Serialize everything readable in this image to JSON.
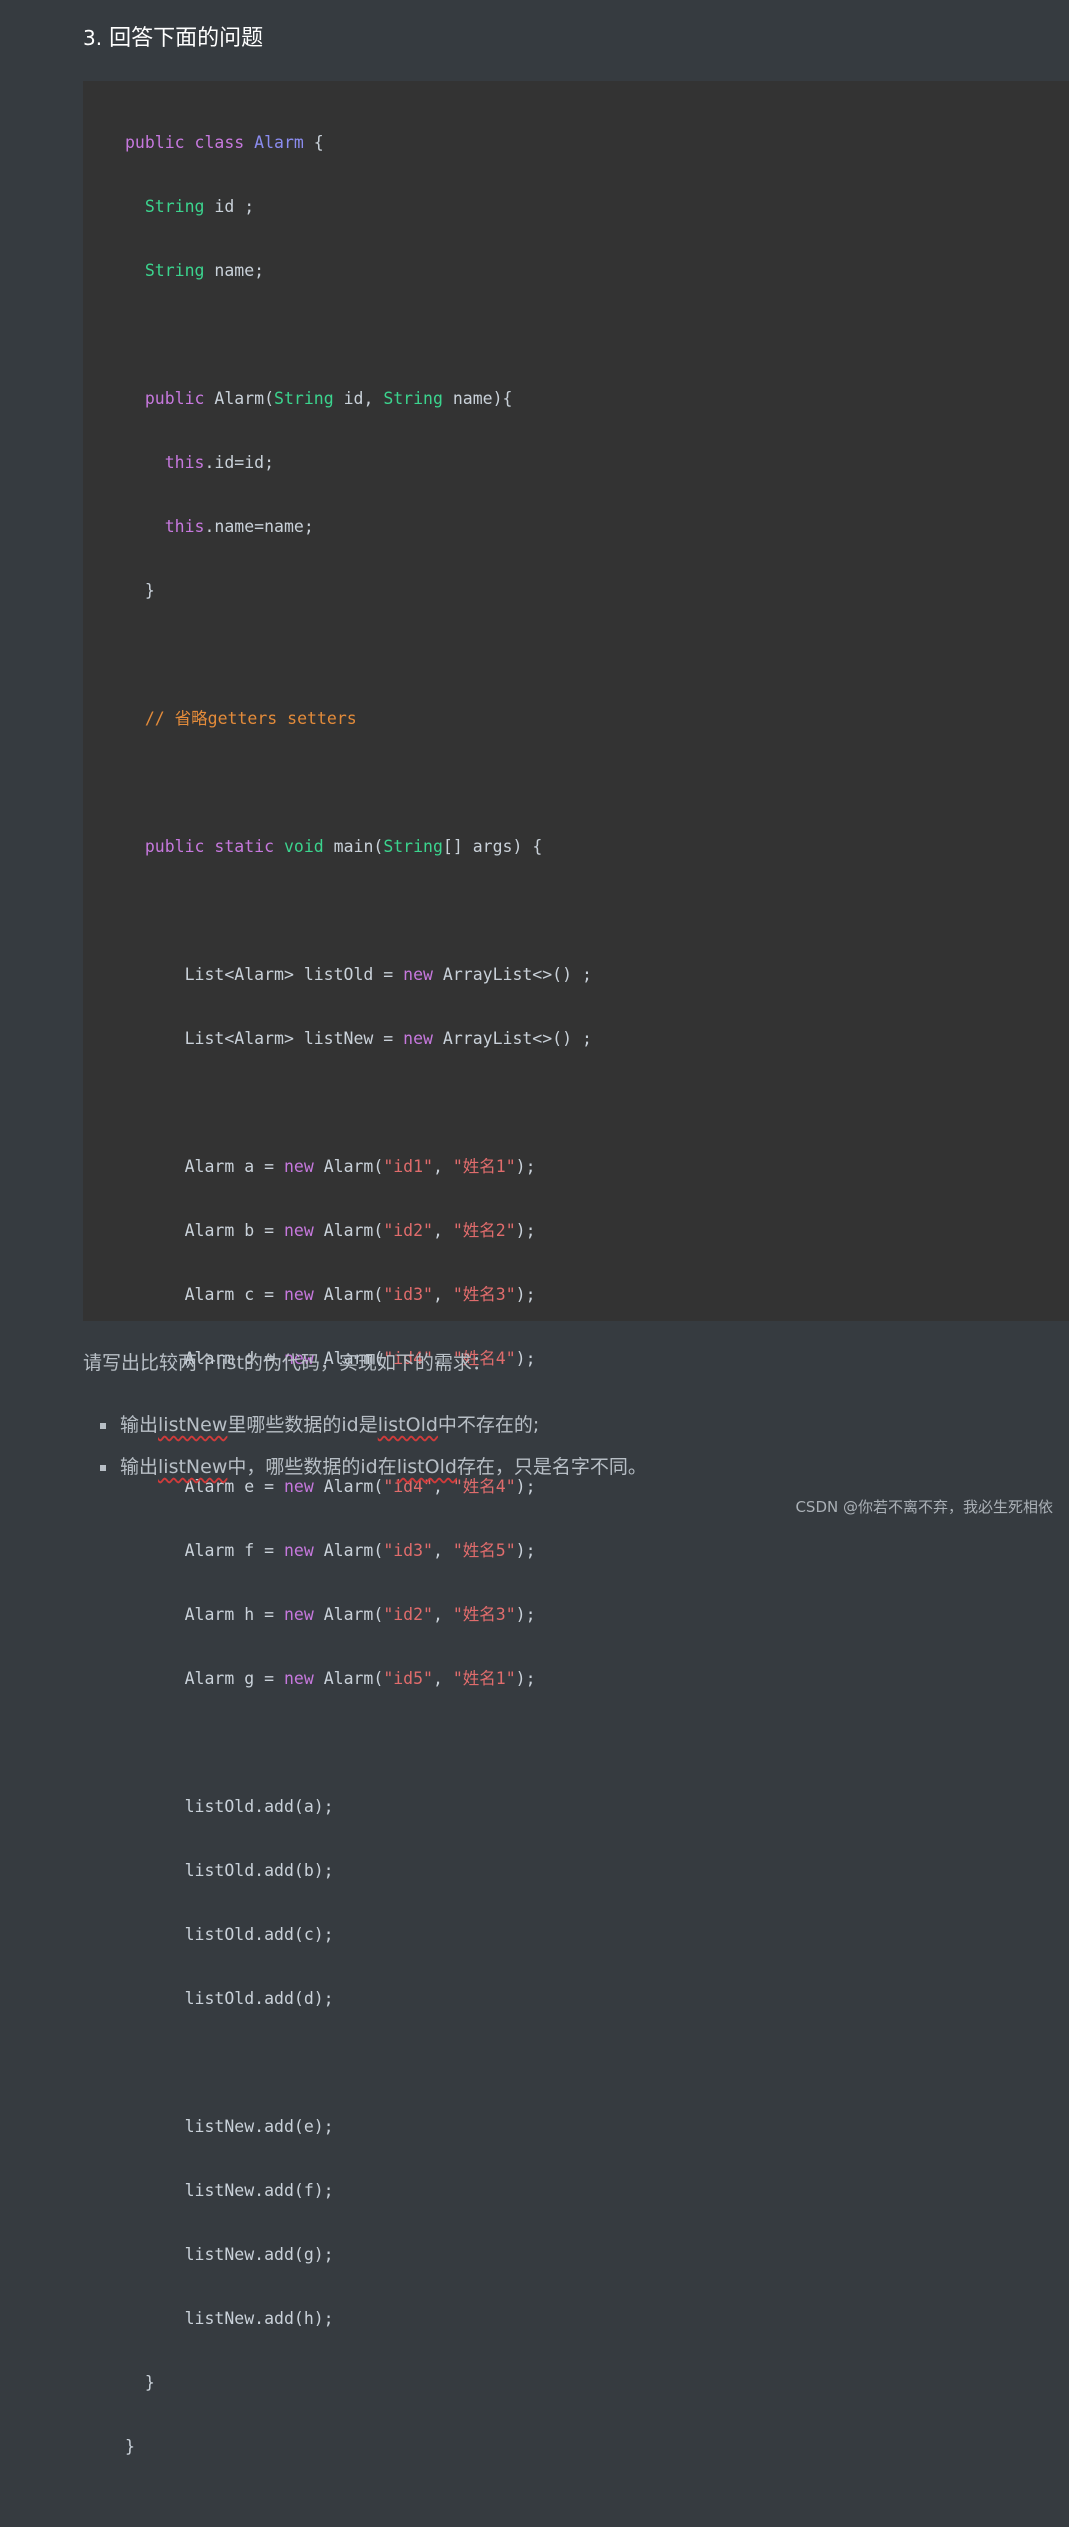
{
  "heading": {
    "number": "3.",
    "text": "回答下面的问题"
  },
  "code": {
    "l1_kw": "public class",
    "l1_cls": "Alarm",
    "l1_rest": " {",
    "type_String": "String",
    "l2_rest": " id ;",
    "l3_rest": " name;",
    "l5_kw": "public",
    "l5_a": " Alarm(",
    "l5_b": " id, ",
    "l5_c": " name){",
    "this": "this",
    "l6_rest": ".id=id;",
    "l7_rest": ".name=name;",
    "close_brace": "}",
    "comment": "// 省略getters setters",
    "l12_kw": "public static",
    "l12_void": "void",
    "l12_a": " main(",
    "l12_b": "[] args) {",
    "list_old_decl_a": "List<Alarm> listOld = ",
    "list_new_decl_a": "List<Alarm> listNew = ",
    "new": "new",
    "arraylist": " ArrayList<>() ;",
    "alarms": [
      {
        "var": "Alarm a = ",
        "id": "\"id1\"",
        "name": "\"姓名1\""
      },
      {
        "var": "Alarm b = ",
        "id": "\"id2\"",
        "name": "\"姓名2\""
      },
      {
        "var": "Alarm c = ",
        "id": "\"id3\"",
        "name": "\"姓名3\""
      },
      {
        "var": "Alarm d = ",
        "id": "\"id4\"",
        "name": "\"姓名4\""
      },
      {
        "var": "Alarm e = ",
        "id": "\"id4\"",
        "name": "\"姓名4\""
      },
      {
        "var": "Alarm f = ",
        "id": "\"id3\"",
        "name": "\"姓名5\""
      },
      {
        "var": "Alarm h = ",
        "id": "\"id2\"",
        "name": "\"姓名3\""
      },
      {
        "var": "Alarm g = ",
        "id": "\"id5\"",
        "name": "\"姓名1\""
      }
    ],
    "alarm_ctor": " Alarm(",
    "comma": ", ",
    "ctor_end": ");",
    "adds_old": [
      "listOld.add(a);",
      "listOld.add(b);",
      "listOld.add(c);",
      "listOld.add(d);"
    ],
    "adds_new": [
      "listNew.add(e);",
      "listNew.add(f);",
      "listNew.add(g);",
      "listNew.add(h);"
    ]
  },
  "paragraph": "请写出比较两个list的伪代码，实现如下的需求：",
  "bullets": [
    {
      "a": "输出",
      "b": "listNew",
      "c": "里哪些数据的id是",
      "d": "listOld",
      "e": "中不存在的;"
    },
    {
      "a": "输出",
      "b": "listNew",
      "c": "中，哪些数据的id在",
      "d": "listOld",
      "e": "存在，只是名字不同。"
    }
  ],
  "watermark": "CSDN @你若不离不弃，我必生死相依"
}
